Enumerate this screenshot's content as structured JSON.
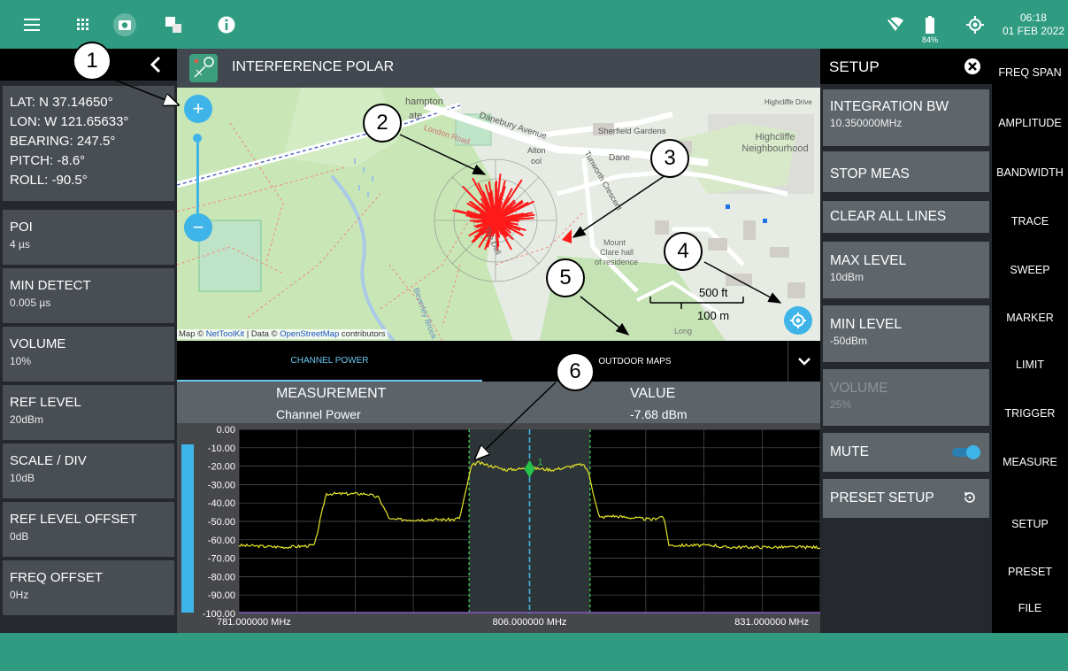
{
  "topbar": {
    "time": "06:18",
    "date": "01 FEB 2022",
    "battery": "84%",
    "icons": [
      "menu-icon",
      "apps-grid-icon",
      "camera-icon",
      "screen-split-icon",
      "info-icon",
      "wifi-off-icon",
      "battery-icon",
      "gps-locate-icon"
    ]
  },
  "left_panel": {
    "gps": {
      "lat": "LAT: N 37.14650°",
      "lon": "LON: W 121.65633°",
      "bearing": "BEARING: 247.5°",
      "pitch": "PITCH: -8.6°",
      "roll": "ROLL: -90.5°"
    },
    "items": [
      {
        "label": "POI",
        "value": "4 µs"
      },
      {
        "label": "MIN DETECT",
        "value": "0.005 µs"
      },
      {
        "label": "VOLUME",
        "value": "10%"
      },
      {
        "label": "REF LEVEL",
        "value": "20dBm"
      },
      {
        "label": "SCALE / DIV",
        "value": "10dB"
      },
      {
        "label": "REF LEVEL OFFSET",
        "value": "0dB"
      },
      {
        "label": "FREQ OFFSET",
        "value": "0Hz"
      }
    ]
  },
  "title": "INTERFERENCE POLAR",
  "map": {
    "labels": [
      "hampton",
      "ate",
      "Danebury Avenue",
      "Sherfield Gardens",
      "Highcliffe Neighbourhood",
      "Highcliffe Drive",
      "Dane",
      "Alton",
      "ool",
      "Tunworth Crescent",
      "Mount",
      "Clare hall",
      "of residence",
      "The Dell",
      "London Road",
      "Beverley Brook",
      "Long"
    ],
    "scale_ft": "500 ft",
    "scale_m": "100 m",
    "attribution_prefix": "Map ©",
    "attribution_link1": "NetToolKit",
    "attribution_mid": "| Data ©",
    "attribution_link2": "OpenStreetMap",
    "attribution_suffix": "contributors"
  },
  "tabs": {
    "channel_power": "CHANNEL POWER",
    "outdoor_maps": "OUTDOOR MAPS"
  },
  "measurement": {
    "header_measurement": "MEASUREMENT",
    "header_value": "VALUE",
    "name": "Channel Power",
    "value": "-7.68 dBm"
  },
  "chart_data": {
    "type": "line",
    "y_ticks": [
      "0.00",
      "-10.00",
      "-20.00",
      "-30.00",
      "-40.00",
      "-50.00",
      "-60.00",
      "-70.00",
      "-80.00",
      "-90.00",
      "-100.00"
    ],
    "ylim": [
      -100,
      0
    ],
    "xlim": [
      781,
      831
    ],
    "x_ticks": [
      "781.000000 MHz",
      "806.000000 MHz",
      "831.000000 MHz"
    ],
    "x": [
      781,
      785,
      787.5,
      788.5,
      792,
      793,
      794,
      799.5,
      800,
      801,
      801.5,
      804,
      806,
      808,
      810.5,
      811,
      812,
      813,
      816.5,
      817.5,
      818,
      822,
      822.5,
      831
    ],
    "series": [
      {
        "values": [
          -63,
          -64,
          -63,
          -35,
          -35,
          -37,
          -49,
          -49,
          -48,
          -20,
          -18,
          -22,
          -21,
          -22,
          -19,
          -22,
          -48,
          -47,
          -49,
          -47,
          -63,
          -63,
          -64,
          -64
        ]
      }
    ],
    "marker": {
      "label": "1",
      "x": 806
    },
    "integration_band": [
      800.8,
      811.2
    ]
  },
  "setup": {
    "title": "SETUP",
    "buttons": [
      {
        "label": "INTEGRATION BW",
        "value": "10.350000MHz"
      },
      {
        "label": "STOP MEAS",
        "value": ""
      },
      {
        "label": "CLEAR ALL LINES",
        "value": ""
      },
      {
        "label": "MAX LEVEL",
        "value": "10dBm"
      },
      {
        "label": "MIN LEVEL",
        "value": "-50dBm"
      },
      {
        "label": "VOLUME",
        "value": "25%"
      },
      {
        "label": "MUTE",
        "value": ""
      },
      {
        "label": "PRESET SETUP",
        "value": ""
      }
    ]
  },
  "right_menu": [
    "FREQ SPAN",
    "AMPLITUDE",
    "BANDWIDTH",
    "TRACE",
    "SWEEP",
    "MARKER",
    "LIMIT",
    "TRIGGER",
    "MEASURE",
    "SETUP",
    "PRESET",
    "FILE"
  ],
  "callouts": [
    "1",
    "2",
    "3",
    "4",
    "5",
    "6"
  ]
}
